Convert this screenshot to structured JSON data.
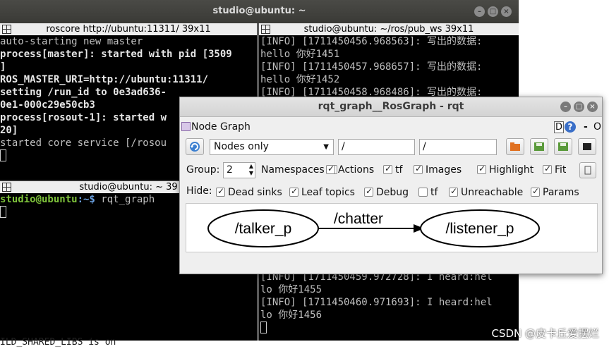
{
  "terminal": {
    "title": "studio@ubuntu: ~",
    "pane_roscore": {
      "title": "roscore http://ubuntu:11311/ 39x11",
      "lines": [
        "auto-starting new master",
        "process[master]: started with pid [3509",
        "]",
        "ROS_MASTER_URI=http://ubuntu:11311/",
        "",
        "setting /run_id to 0e3ad636-",
        "0e1-000c29e50cb3",
        "process[rosout-1]: started w",
        "20]",
        "started core service [/rosou"
      ]
    },
    "pane_shell": {
      "title": "studio@ubuntu: ~ 39",
      "prompt_user": "studio@ubuntu",
      "prompt_path": ":~$ ",
      "command": "rqt_graph"
    },
    "pane_pub": {
      "title": "studio@ubuntu: ~/ros/pub_ws 39x11",
      "lines_top": [
        "[INFO] [1711450456.968563]: 写出的数据:",
        "hello 你好1451",
        "[INFO] [1711450457.968657]: 写出的数据:",
        "hello 你好1452",
        "[INFO] [1711450458.968486]: 写出的数据:"
      ],
      "lines_bottom": [
        "[INFO] [1711450459.972728]: I heard:hel",
        "lo 你好1455",
        "[INFO] [1711450460.971693]: I heard:hel",
        "lo 你好1456"
      ]
    },
    "bottom_text": "ILD_SHARED_LIBS is on"
  },
  "watermark": "CSDN @皮卡丘爱摆烂",
  "rqt": {
    "title": "rqt_graph__RosGraph - rqt",
    "plugin_title": "Node Graph",
    "d_label": "D",
    "help_label": "?",
    "dash_label": "-",
    "o_label": "O",
    "mode_select": "Nodes only",
    "filter_1": "/",
    "filter_2": "/",
    "group_label": "Group:",
    "group_value": "2",
    "checks_row1": [
      {
        "label": "Namespaces",
        "checked": true
      },
      {
        "label": "Actions",
        "checked": true
      },
      {
        "label": "tf",
        "checked": true
      },
      {
        "label": "Images",
        "checked": true
      },
      {
        "label": "Highlight",
        "checked": true
      },
      {
        "label": "Fit",
        "checked": true
      }
    ],
    "hide_label": "Hide:",
    "checks_row2": [
      {
        "label": "Dead sinks",
        "checked": true
      },
      {
        "label": "Leaf topics",
        "checked": true
      },
      {
        "label": "Debug",
        "checked": true
      },
      {
        "label": "tf",
        "checked": false
      },
      {
        "label": "Unreachable",
        "checked": true
      },
      {
        "label": "Params",
        "checked": true
      }
    ],
    "graph": {
      "node_1": "/talker_p",
      "edge_label": "/chatter",
      "node_2": "/listener_p"
    }
  }
}
